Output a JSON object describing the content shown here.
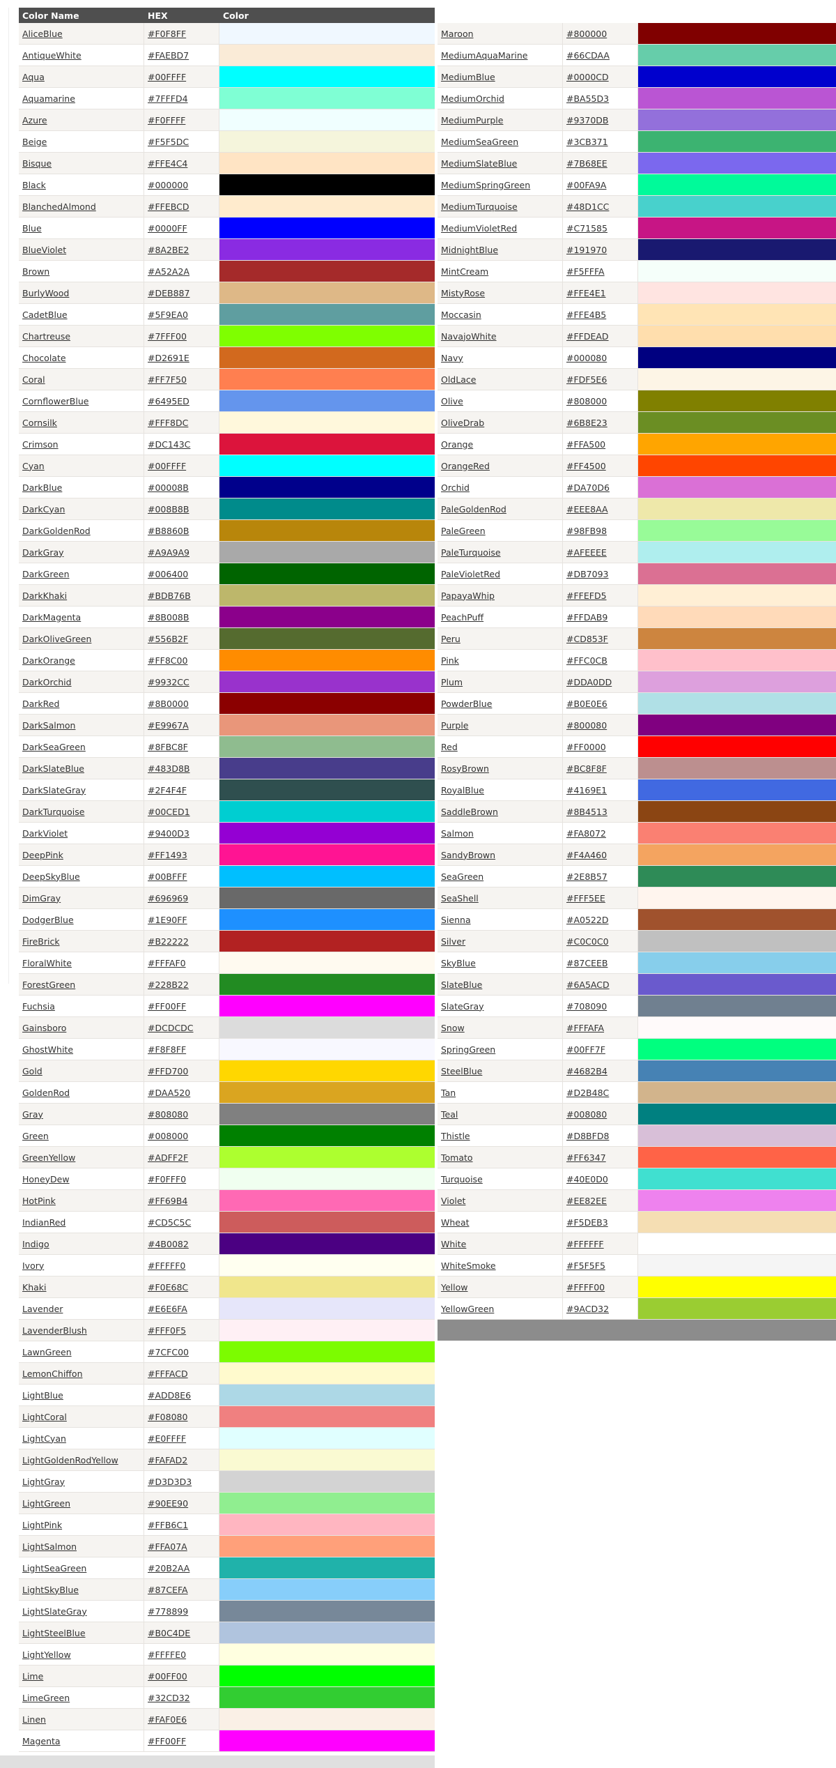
{
  "header": {
    "name": "Color Name",
    "hex": "HEX",
    "color": "Color"
  },
  "left_colors": [
    {
      "name": "AliceBlue",
      "hex": "#F0F8FF"
    },
    {
      "name": "AntiqueWhite",
      "hex": "#FAEBD7"
    },
    {
      "name": "Aqua",
      "hex": "#00FFFF"
    },
    {
      "name": "Aquamarine",
      "hex": "#7FFFD4"
    },
    {
      "name": "Azure",
      "hex": "#F0FFFF"
    },
    {
      "name": "Beige",
      "hex": "#F5F5DC"
    },
    {
      "name": "Bisque",
      "hex": "#FFE4C4"
    },
    {
      "name": "Black",
      "hex": "#000000"
    },
    {
      "name": "BlanchedAlmond",
      "hex": "#FFEBCD"
    },
    {
      "name": "Blue",
      "hex": "#0000FF"
    },
    {
      "name": "BlueViolet",
      "hex": "#8A2BE2"
    },
    {
      "name": "Brown",
      "hex": "#A52A2A"
    },
    {
      "name": "BurlyWood",
      "hex": "#DEB887"
    },
    {
      "name": "CadetBlue",
      "hex": "#5F9EA0"
    },
    {
      "name": "Chartreuse",
      "hex": "#7FFF00"
    },
    {
      "name": "Chocolate",
      "hex": "#D2691E"
    },
    {
      "name": "Coral",
      "hex": "#FF7F50"
    },
    {
      "name": "CornflowerBlue",
      "hex": "#6495ED"
    },
    {
      "name": "Cornsilk",
      "hex": "#FFF8DC"
    },
    {
      "name": "Crimson",
      "hex": "#DC143C"
    },
    {
      "name": "Cyan",
      "hex": "#00FFFF"
    },
    {
      "name": "DarkBlue",
      "hex": "#00008B"
    },
    {
      "name": "DarkCyan",
      "hex": "#008B8B"
    },
    {
      "name": "DarkGoldenRod",
      "hex": "#B8860B"
    },
    {
      "name": "DarkGray",
      "hex": "#A9A9A9"
    },
    {
      "name": "DarkGreen",
      "hex": "#006400"
    },
    {
      "name": "DarkKhaki",
      "hex": "#BDB76B"
    },
    {
      "name": "DarkMagenta",
      "hex": "#8B008B"
    },
    {
      "name": "DarkOliveGreen",
      "hex": "#556B2F"
    },
    {
      "name": "DarkOrange",
      "hex": "#FF8C00"
    },
    {
      "name": "DarkOrchid",
      "hex": "#9932CC"
    },
    {
      "name": "DarkRed",
      "hex": "#8B0000"
    },
    {
      "name": "DarkSalmon",
      "hex": "#E9967A"
    },
    {
      "name": "DarkSeaGreen",
      "hex": "#8FBC8F"
    },
    {
      "name": "DarkSlateBlue",
      "hex": "#483D8B"
    },
    {
      "name": "DarkSlateGray",
      "hex": "#2F4F4F"
    },
    {
      "name": "DarkTurquoise",
      "hex": "#00CED1"
    },
    {
      "name": "DarkViolet",
      "hex": "#9400D3"
    },
    {
      "name": "DeepPink",
      "hex": "#FF1493"
    },
    {
      "name": "DeepSkyBlue",
      "hex": "#00BFFF"
    },
    {
      "name": "DimGray",
      "hex": "#696969"
    },
    {
      "name": "DodgerBlue",
      "hex": "#1E90FF"
    },
    {
      "name": "FireBrick",
      "hex": "#B22222"
    },
    {
      "name": "FloralWhite",
      "hex": "#FFFAF0"
    },
    {
      "name": "ForestGreen",
      "hex": "#228B22"
    },
    {
      "name": "Fuchsia",
      "hex": "#FF00FF"
    },
    {
      "name": "Gainsboro",
      "hex": "#DCDCDC"
    },
    {
      "name": "GhostWhite",
      "hex": "#F8F8FF"
    },
    {
      "name": "Gold",
      "hex": "#FFD700"
    },
    {
      "name": "GoldenRod",
      "hex": "#DAA520"
    },
    {
      "name": "Gray",
      "hex": "#808080"
    },
    {
      "name": "Green",
      "hex": "#008000"
    },
    {
      "name": "GreenYellow",
      "hex": "#ADFF2F"
    },
    {
      "name": "HoneyDew",
      "hex": "#F0FFF0"
    },
    {
      "name": "HotPink",
      "hex": "#FF69B4"
    },
    {
      "name": "IndianRed",
      "hex": "#CD5C5C"
    },
    {
      "name": "Indigo",
      "hex": "#4B0082"
    },
    {
      "name": "Ivory",
      "hex": "#FFFFF0"
    },
    {
      "name": "Khaki",
      "hex": "#F0E68C"
    },
    {
      "name": "Lavender",
      "hex": "#E6E6FA"
    },
    {
      "name": "LavenderBlush",
      "hex": "#FFF0F5"
    },
    {
      "name": "LawnGreen",
      "hex": "#7CFC00"
    },
    {
      "name": "LemonChiffon",
      "hex": "#FFFACD"
    },
    {
      "name": "LightBlue",
      "hex": "#ADD8E6"
    },
    {
      "name": "LightCoral",
      "hex": "#F08080"
    },
    {
      "name": "LightCyan",
      "hex": "#E0FFFF"
    },
    {
      "name": "LightGoldenRodYellow",
      "hex": "#FAFAD2"
    },
    {
      "name": "LightGray",
      "hex": "#D3D3D3"
    },
    {
      "name": "LightGreen",
      "hex": "#90EE90"
    },
    {
      "name": "LightPink",
      "hex": "#FFB6C1"
    },
    {
      "name": "LightSalmon",
      "hex": "#FFA07A"
    },
    {
      "name": "LightSeaGreen",
      "hex": "#20B2AA"
    },
    {
      "name": "LightSkyBlue",
      "hex": "#87CEFA"
    },
    {
      "name": "LightSlateGray",
      "hex": "#778899"
    },
    {
      "name": "LightSteelBlue",
      "hex": "#B0C4DE"
    },
    {
      "name": "LightYellow",
      "hex": "#FFFFE0"
    },
    {
      "name": "Lime",
      "hex": "#00FF00"
    },
    {
      "name": "LimeGreen",
      "hex": "#32CD32"
    },
    {
      "name": "Linen",
      "hex": "#FAF0E6"
    },
    {
      "name": "Magenta",
      "hex": "#FF00FF"
    }
  ],
  "right_colors": [
    {
      "name": "Maroon",
      "hex": "#800000"
    },
    {
      "name": "MediumAquaMarine",
      "hex": "#66CDAA"
    },
    {
      "name": "MediumBlue",
      "hex": "#0000CD"
    },
    {
      "name": "MediumOrchid",
      "hex": "#BA55D3"
    },
    {
      "name": "MediumPurple",
      "hex": "#9370DB"
    },
    {
      "name": "MediumSeaGreen",
      "hex": "#3CB371"
    },
    {
      "name": "MediumSlateBlue",
      "hex": "#7B68EE"
    },
    {
      "name": "MediumSpringGreen",
      "hex": "#00FA9A"
    },
    {
      "name": "MediumTurquoise",
      "hex": "#48D1CC"
    },
    {
      "name": "MediumVioletRed",
      "hex": "#C71585"
    },
    {
      "name": "MidnightBlue",
      "hex": "#191970"
    },
    {
      "name": "MintCream",
      "hex": "#F5FFFA"
    },
    {
      "name": "MistyRose",
      "hex": "#FFE4E1"
    },
    {
      "name": "Moccasin",
      "hex": "#FFE4B5"
    },
    {
      "name": "NavajoWhite",
      "hex": "#FFDEAD"
    },
    {
      "name": "Navy",
      "hex": "#000080"
    },
    {
      "name": "OldLace",
      "hex": "#FDF5E6"
    },
    {
      "name": "Olive",
      "hex": "#808000"
    },
    {
      "name": "OliveDrab",
      "hex": "#6B8E23"
    },
    {
      "name": "Orange",
      "hex": "#FFA500"
    },
    {
      "name": "OrangeRed",
      "hex": "#FF4500"
    },
    {
      "name": "Orchid",
      "hex": "#DA70D6"
    },
    {
      "name": "PaleGoldenRod",
      "hex": "#EEE8AA"
    },
    {
      "name": "PaleGreen",
      "hex": "#98FB98"
    },
    {
      "name": "PaleTurquoise",
      "hex": "#AFEEEE"
    },
    {
      "name": "PaleVioletRed",
      "hex": "#DB7093"
    },
    {
      "name": "PapayaWhip",
      "hex": "#FFEFD5"
    },
    {
      "name": "PeachPuff",
      "hex": "#FFDAB9"
    },
    {
      "name": "Peru",
      "hex": "#CD853F"
    },
    {
      "name": "Pink",
      "hex": "#FFC0CB"
    },
    {
      "name": "Plum",
      "hex": "#DDA0DD"
    },
    {
      "name": "PowderBlue",
      "hex": "#B0E0E6"
    },
    {
      "name": "Purple",
      "hex": "#800080"
    },
    {
      "name": "Red",
      "hex": "#FF0000"
    },
    {
      "name": "RosyBrown",
      "hex": "#BC8F8F"
    },
    {
      "name": "RoyalBlue",
      "hex": "#4169E1"
    },
    {
      "name": "SaddleBrown",
      "hex": "#8B4513"
    },
    {
      "name": "Salmon",
      "hex": "#FA8072"
    },
    {
      "name": "SandyBrown",
      "hex": "#F4A460"
    },
    {
      "name": "SeaGreen",
      "hex": "#2E8B57"
    },
    {
      "name": "SeaShell",
      "hex": "#FFF5EE"
    },
    {
      "name": "Sienna",
      "hex": "#A0522D"
    },
    {
      "name": "Silver",
      "hex": "#C0C0C0"
    },
    {
      "name": "SkyBlue",
      "hex": "#87CEEB"
    },
    {
      "name": "SlateBlue",
      "hex": "#6A5ACD"
    },
    {
      "name": "SlateGray",
      "hex": "#708090"
    },
    {
      "name": "Snow",
      "hex": "#FFFAFA"
    },
    {
      "name": "SpringGreen",
      "hex": "#00FF7F"
    },
    {
      "name": "SteelBlue",
      "hex": "#4682B4"
    },
    {
      "name": "Tan",
      "hex": "#D2B48C"
    },
    {
      "name": "Teal",
      "hex": "#008080"
    },
    {
      "name": "Thistle",
      "hex": "#D8BFD8"
    },
    {
      "name": "Tomato",
      "hex": "#FF6347"
    },
    {
      "name": "Turquoise",
      "hex": "#40E0D0"
    },
    {
      "name": "Violet",
      "hex": "#EE82EE"
    },
    {
      "name": "Wheat",
      "hex": "#F5DEB3"
    },
    {
      "name": "White",
      "hex": "#FFFFFF"
    },
    {
      "name": "WhiteSmoke",
      "hex": "#F5F5F5"
    },
    {
      "name": "Yellow",
      "hex": "#FFFF00"
    },
    {
      "name": "YellowGreen",
      "hex": "#9ACD32"
    }
  ]
}
